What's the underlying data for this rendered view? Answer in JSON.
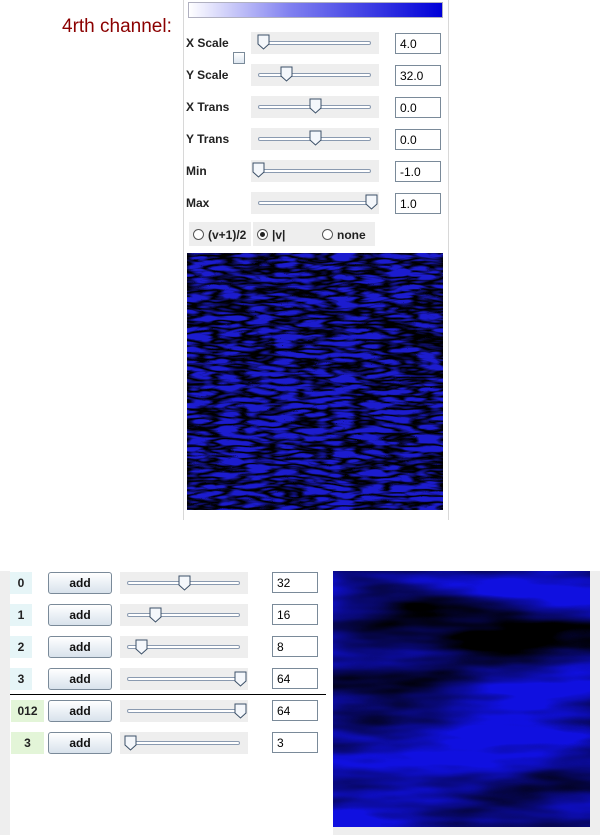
{
  "channel": {
    "title": "4rth channel:",
    "params": [
      {
        "label": "X Scale",
        "value": "4.0",
        "pos": 0.04
      },
      {
        "label": "Y Scale",
        "value": "32.0",
        "pos": 0.25
      },
      {
        "label": "X Trans",
        "value": "0.0",
        "pos": 0.5
      },
      {
        "label": "Y Trans",
        "value": "0.0",
        "pos": 0.5
      },
      {
        "label": "Min",
        "value": "-1.0",
        "pos": 0.0
      },
      {
        "label": "Max",
        "value": "1.0",
        "pos": 1.0
      }
    ],
    "modes": [
      {
        "label": "(v+1)/2",
        "selected": false
      },
      {
        "label": "|v|",
        "selected": true
      },
      {
        "label": "none",
        "selected": false
      }
    ],
    "gradient": {
      "start": "#ffffff",
      "end": "#0000d8"
    }
  },
  "octaves": {
    "rows": [
      {
        "index": "0",
        "button": "add",
        "value": "32",
        "pos": 0.5,
        "group": "base"
      },
      {
        "index": "1",
        "button": "add",
        "value": "16",
        "pos": 0.25,
        "group": "base"
      },
      {
        "index": "2",
        "button": "add",
        "value": "8",
        "pos": 0.12,
        "group": "base"
      },
      {
        "index": "3",
        "button": "add",
        "value": "64",
        "pos": 1.0,
        "group": "base"
      },
      {
        "index": "012",
        "button": "add",
        "value": "64",
        "pos": 1.0,
        "group": "combined"
      },
      {
        "index": "3",
        "button": "add",
        "value": "3",
        "pos": 0.03,
        "group": "combined"
      }
    ]
  },
  "colors": {
    "title": "#8b0000",
    "noise_blue": "#1a1ad8",
    "noise_light": "#e8ecff"
  }
}
